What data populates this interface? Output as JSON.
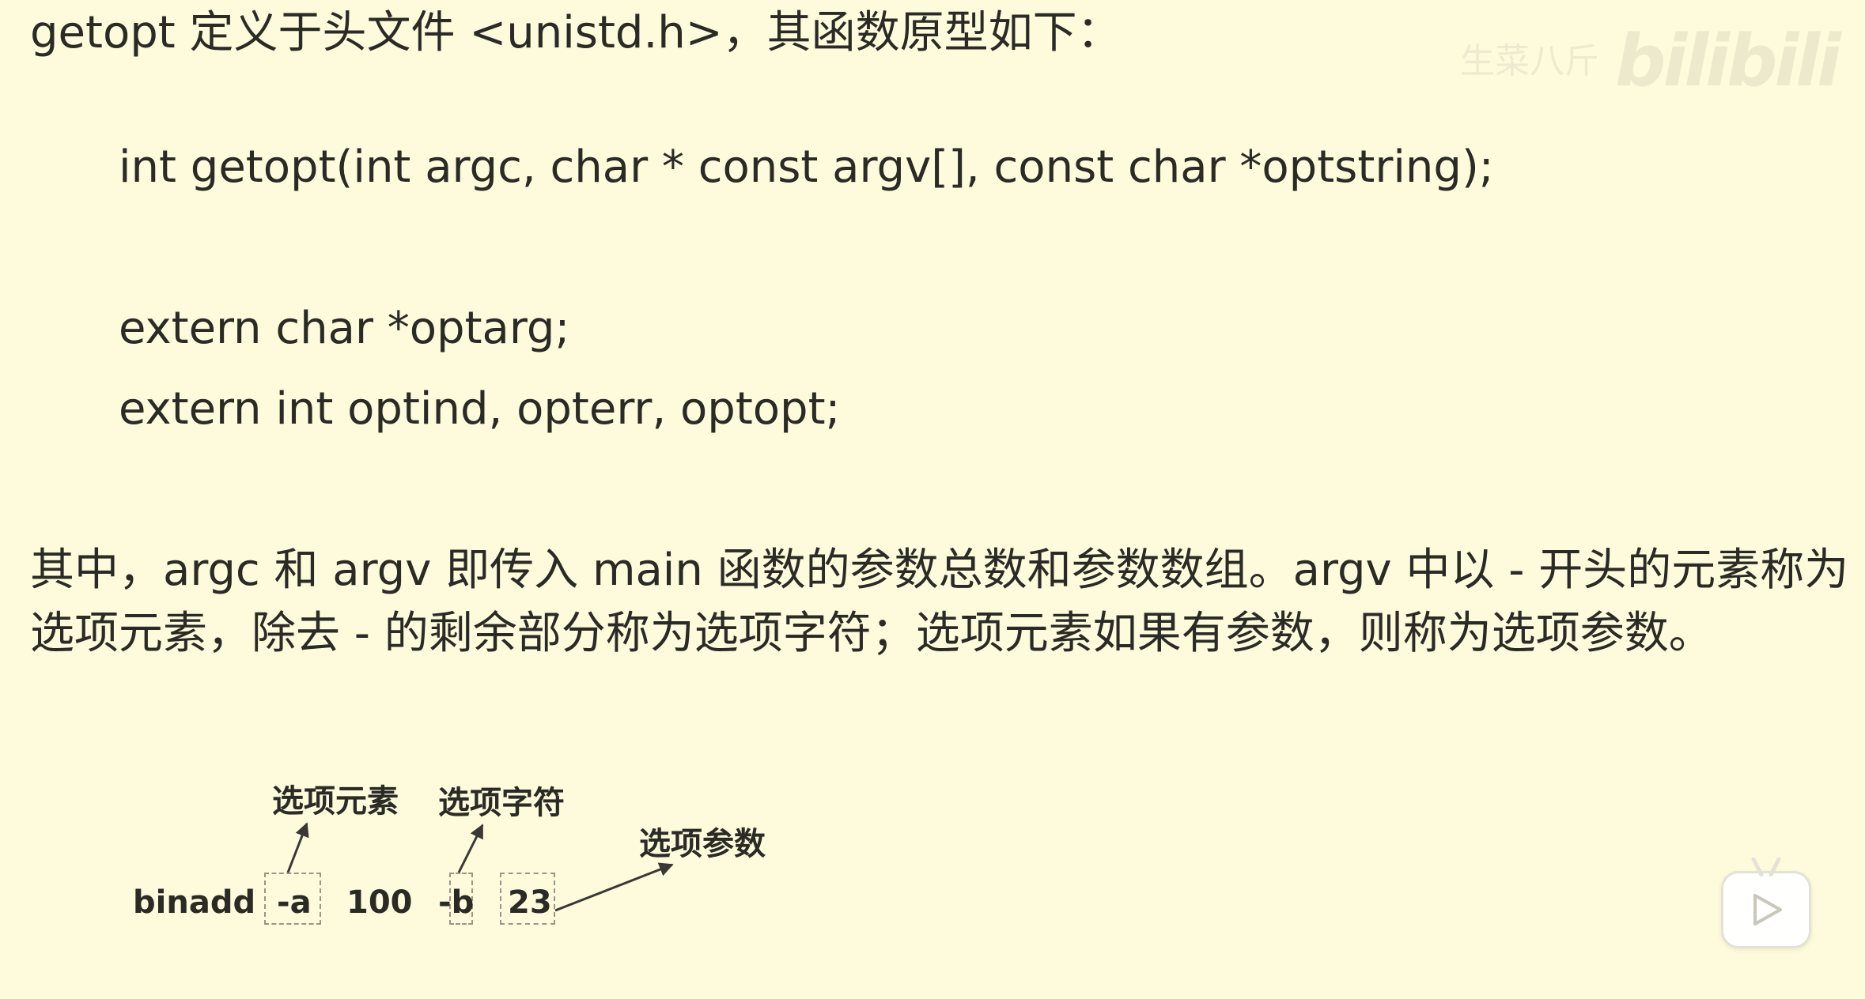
{
  "intro": "getopt 定义于头文件 <unistd.h>，其函数原型如下：",
  "code": {
    "line1": "int getopt(int argc, char * const argv[], const char *optstring);",
    "line2": "extern char *optarg;",
    "line3": "extern int optind, opterr, optopt;"
  },
  "paragraph": {
    "line1": "其中，argc 和 argv 即传入 main 函数的参数总数和参数数组。argv 中以 - 开头的元素称为",
    "line2": "选项元素，除去 - 的剩余部分称为选项字符；选项元素如果有参数，则称为选项参数。"
  },
  "diagram": {
    "labels": {
      "option_element": "选项元素",
      "option_char": "选项字符",
      "option_arg": "选项参数"
    },
    "command": [
      "binadd",
      "-a",
      "100",
      "-b",
      "23"
    ]
  },
  "watermark": {
    "text": "生菜八斤",
    "logo": "bilibili"
  },
  "colors": {
    "background": "#fdfbdc",
    "text": "#2b2a25",
    "dashed_box": "#9a9688"
  }
}
